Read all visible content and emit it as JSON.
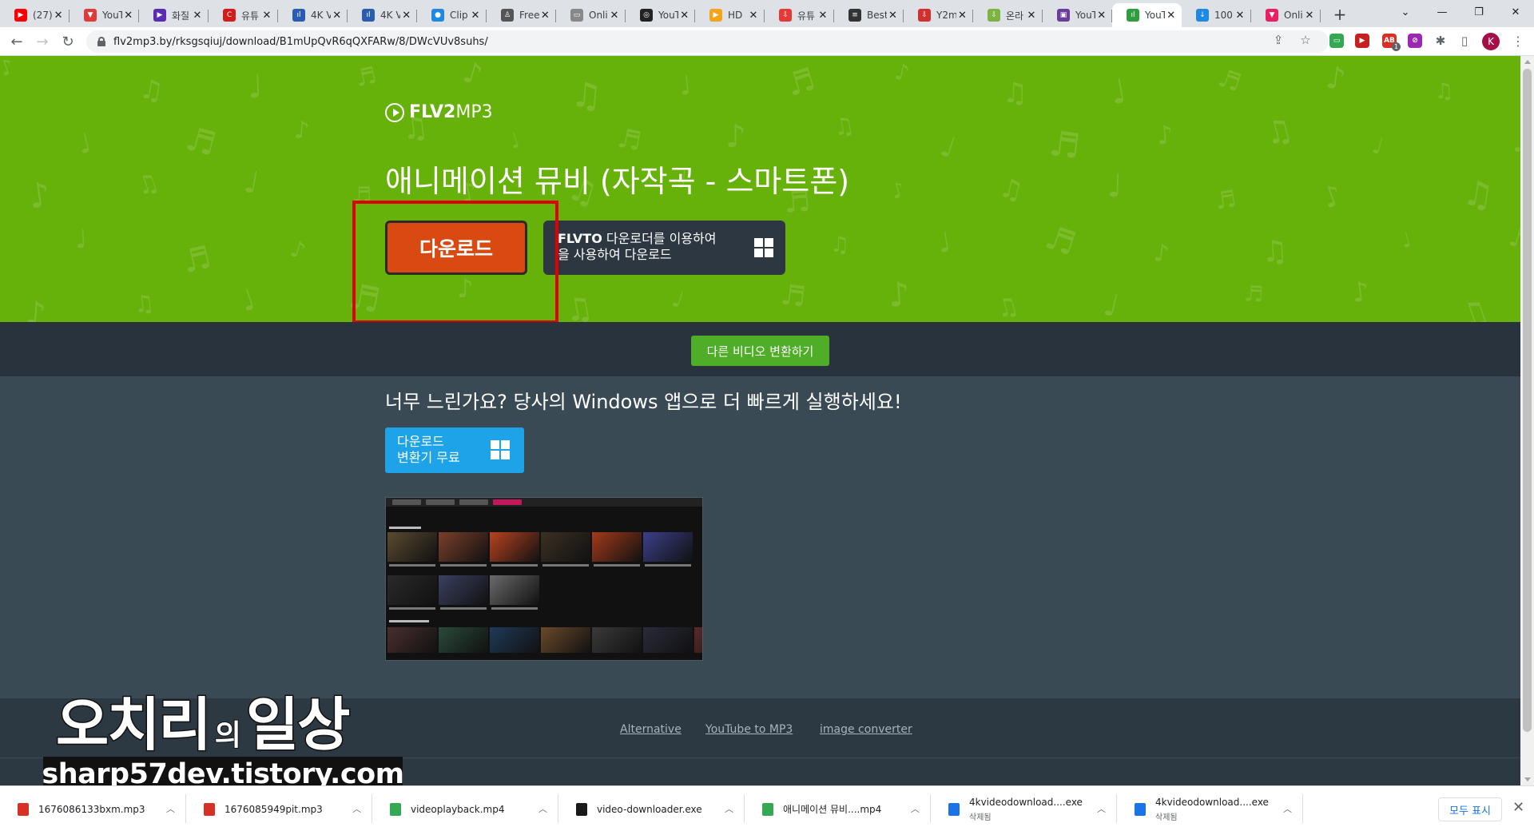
{
  "browser": {
    "tabs": [
      {
        "title": "(27)",
        "color": "#ff0000",
        "glyph": "▶"
      },
      {
        "title": "YouT",
        "color": "#e03b3b",
        "glyph": "▼"
      },
      {
        "title": "화질",
        "color": "#5b2bb5",
        "glyph": "▶"
      },
      {
        "title": "유튜",
        "color": "#d41b1b",
        "glyph": "C"
      },
      {
        "title": "4K V",
        "color": "#2a5db0",
        "glyph": "ıl"
      },
      {
        "title": "4K V",
        "color": "#2a5db0",
        "glyph": "ıl"
      },
      {
        "title": "Clip",
        "color": "#1e88e5",
        "glyph": "●"
      },
      {
        "title": "Free",
        "color": "#555555",
        "glyph": "♙"
      },
      {
        "title": "Onli",
        "color": "#888888",
        "glyph": "▭"
      },
      {
        "title": "YouT",
        "color": "#222222",
        "glyph": "◎"
      },
      {
        "title": "HD",
        "color": "#f2a51a",
        "glyph": "▶"
      },
      {
        "title": "유튜",
        "color": "#e53935",
        "glyph": "⇩"
      },
      {
        "title": "Best",
        "color": "#333333",
        "glyph": "≡"
      },
      {
        "title": "Y2m",
        "color": "#d32f2f",
        "glyph": "⇩"
      },
      {
        "title": "온라",
        "color": "#7cb342",
        "glyph": "⇩"
      },
      {
        "title": "YouT",
        "color": "#6a3d9a",
        "glyph": "▣"
      },
      {
        "title": "YouT",
        "color": "#2e9e3f",
        "glyph": "ıl",
        "active": true
      },
      {
        "title": "100",
        "color": "#1e88e5",
        "glyph": "↓"
      },
      {
        "title": "Onli",
        "color": "#e91e63",
        "glyph": "▼"
      }
    ],
    "new_tab_label": "+",
    "window_controls": [
      "⌄",
      "—",
      "❐",
      "✕"
    ],
    "url": "flv2mp3.by/rksgsqiuj/download/B1mUpQvR6qQXFARw/8/DWcVUv8suhs/",
    "profile_initial": "K",
    "extension_badge": "1",
    "extensions": [
      {
        "color": "#34a853",
        "glyph": "▭"
      },
      {
        "color": "#c5221f",
        "glyph": "▶"
      },
      {
        "color": "#d93025",
        "glyph": "AB"
      },
      {
        "color": "#9c27b0",
        "glyph": "⊘"
      },
      {
        "color": "#5f6368",
        "glyph": "✱"
      },
      {
        "color": "#5f6368",
        "glyph": "▯"
      }
    ]
  },
  "page": {
    "logo_bold": "FLV2",
    "logo_light": "MP3",
    "video_title": "애니메이션 뮤비 (자작곡 - 스마트폰)",
    "download_button": "다운로드",
    "flvto_brand": "FLVTO",
    "flvto_line1_rest": " 다운로더를 이용하여",
    "flvto_line2": "을 사용하여 다운로드",
    "convert_other": "다른 비디오 변환하기",
    "promo_title": "너무 느린가요? 당사의 Windows 앱으로 더 빠르게 실행하세요!",
    "free_line1": "다운로드",
    "free_line2": "변환기 무료",
    "footer_links": [
      "Alternative",
      "YouTube to MP3",
      "image converter"
    ],
    "colors": {
      "hero_green": "#67b20a",
      "download_orange": "#d94a12",
      "convert_green": "#4fae27",
      "free_blue": "#1ea3e8",
      "dark_bg": "#3a4a55"
    }
  },
  "watermark": {
    "title_a": "오치리",
    "title_small": "의",
    "title_b": "일상",
    "url": "sharp57dev.tistory.com"
  },
  "downloads": [
    {
      "name": "1676086133bxm.mp3",
      "sub": "",
      "icon_color": "#d93025"
    },
    {
      "name": "1676085949pit.mp3",
      "sub": "",
      "icon_color": "#d93025"
    },
    {
      "name": "videoplayback.mp4",
      "sub": "",
      "icon_color": "#34a853"
    },
    {
      "name": "video-downloader.exe",
      "sub": "",
      "icon_color": "#1a1a1a"
    },
    {
      "name": "애니메이션 뮤비....mp4",
      "sub": "",
      "icon_color": "#34a853"
    },
    {
      "name": "4kvideodownload....exe",
      "sub": "삭제됨",
      "icon_color": "#1a73e8"
    },
    {
      "name": "4kvideodownload....exe",
      "sub": "삭제됨",
      "icon_color": "#1a73e8"
    }
  ],
  "shelf": {
    "show_all": "모두 표시",
    "close": "✕"
  }
}
